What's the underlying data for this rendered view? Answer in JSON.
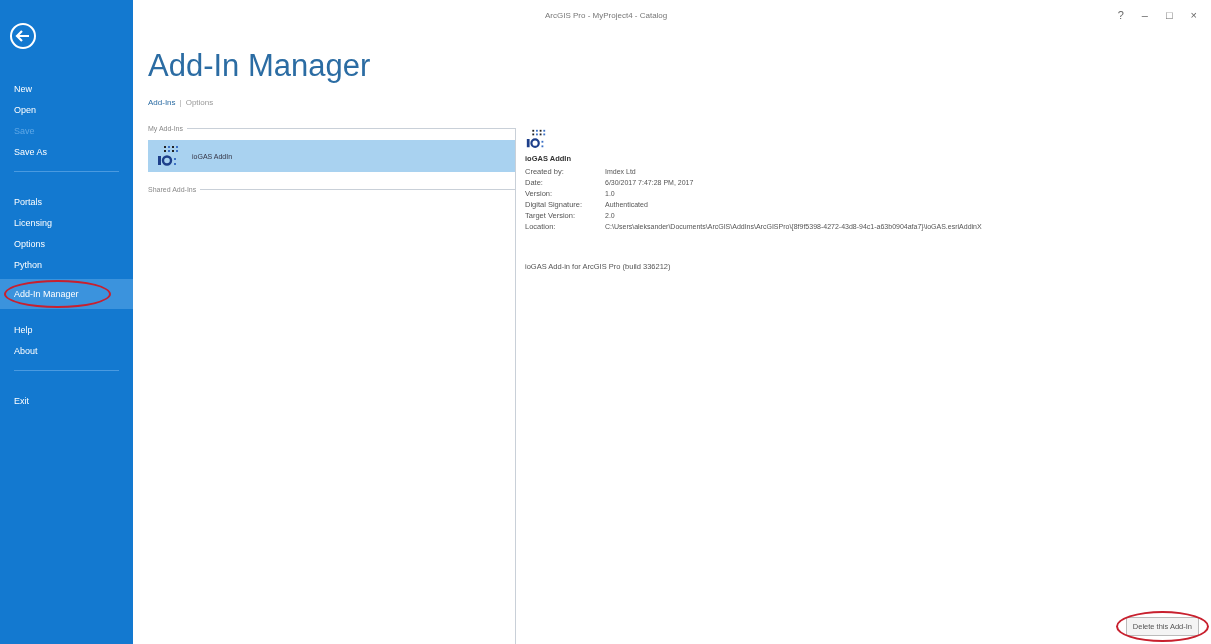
{
  "window": {
    "title": "ArcGIS Pro - MyProject4 - Catalog",
    "controls": [
      "?",
      "–",
      "□",
      "×"
    ]
  },
  "sidebar": {
    "items": [
      {
        "kind": "item",
        "label": "New",
        "disabled": false,
        "selected": false,
        "annotated": false
      },
      {
        "kind": "item",
        "label": "Open",
        "disabled": false,
        "selected": false,
        "annotated": false
      },
      {
        "kind": "item",
        "label": "Save",
        "disabled": true,
        "selected": false,
        "annotated": false
      },
      {
        "kind": "item",
        "label": "Save As",
        "disabled": false,
        "selected": false,
        "annotated": false
      },
      {
        "kind": "divider"
      },
      {
        "kind": "item",
        "label": "Portals",
        "disabled": false,
        "selected": false,
        "annotated": false
      },
      {
        "kind": "item",
        "label": "Licensing",
        "disabled": false,
        "selected": false,
        "annotated": false
      },
      {
        "kind": "item",
        "label": "Options",
        "disabled": false,
        "selected": false,
        "annotated": false
      },
      {
        "kind": "item",
        "label": "Python",
        "disabled": false,
        "selected": false,
        "annotated": false
      },
      {
        "kind": "item",
        "label": "Add-In Manager",
        "disabled": false,
        "selected": true,
        "annotated": true
      },
      {
        "kind": "item",
        "label": "Help",
        "disabled": false,
        "selected": false,
        "annotated": false
      },
      {
        "kind": "item",
        "label": "About",
        "disabled": false,
        "selected": false,
        "annotated": false
      },
      {
        "kind": "divider"
      },
      {
        "kind": "item",
        "label": "Exit",
        "disabled": false,
        "selected": false,
        "annotated": false
      }
    ]
  },
  "page": {
    "title": "Add-In Manager",
    "tabs": [
      {
        "label": "Add-Ins",
        "selected": true
      },
      {
        "label": "Options",
        "selected": false
      }
    ],
    "tab_separator": "|"
  },
  "addins": {
    "groups": [
      {
        "heading": "My Add-Ins",
        "items": [
          {
            "name": "ioGAS AddIn",
            "selected": true
          }
        ]
      },
      {
        "heading": "Shared Add-Ins"
      }
    ]
  },
  "details": {
    "name": "ioGAS AddIn",
    "fields": [
      {
        "label": "Created by:",
        "value": "Imdex Ltd"
      },
      {
        "label": "Date:",
        "value": "6/30/2017 7:47:28 PM, 2017"
      },
      {
        "label": "Version:",
        "value": "1.0"
      },
      {
        "label": "Digital Signature:",
        "value": "Authenticated"
      },
      {
        "label": "Target Version:",
        "value": "2.0"
      },
      {
        "label": "Location:",
        "value": "C:\\Users\\aleksander\\Documents\\ArcGIS\\AddIns\\ArcGISPro\\{8f9f5398-4272-43d8-94c1-a63b0904afa7}\\ioGAS.esriAddinX"
      }
    ],
    "description": "ioGAS Add-in for ArcGIS Pro (build 336212)"
  },
  "delete_button": {
    "label": "Delete this Add-In",
    "annotated": true
  }
}
